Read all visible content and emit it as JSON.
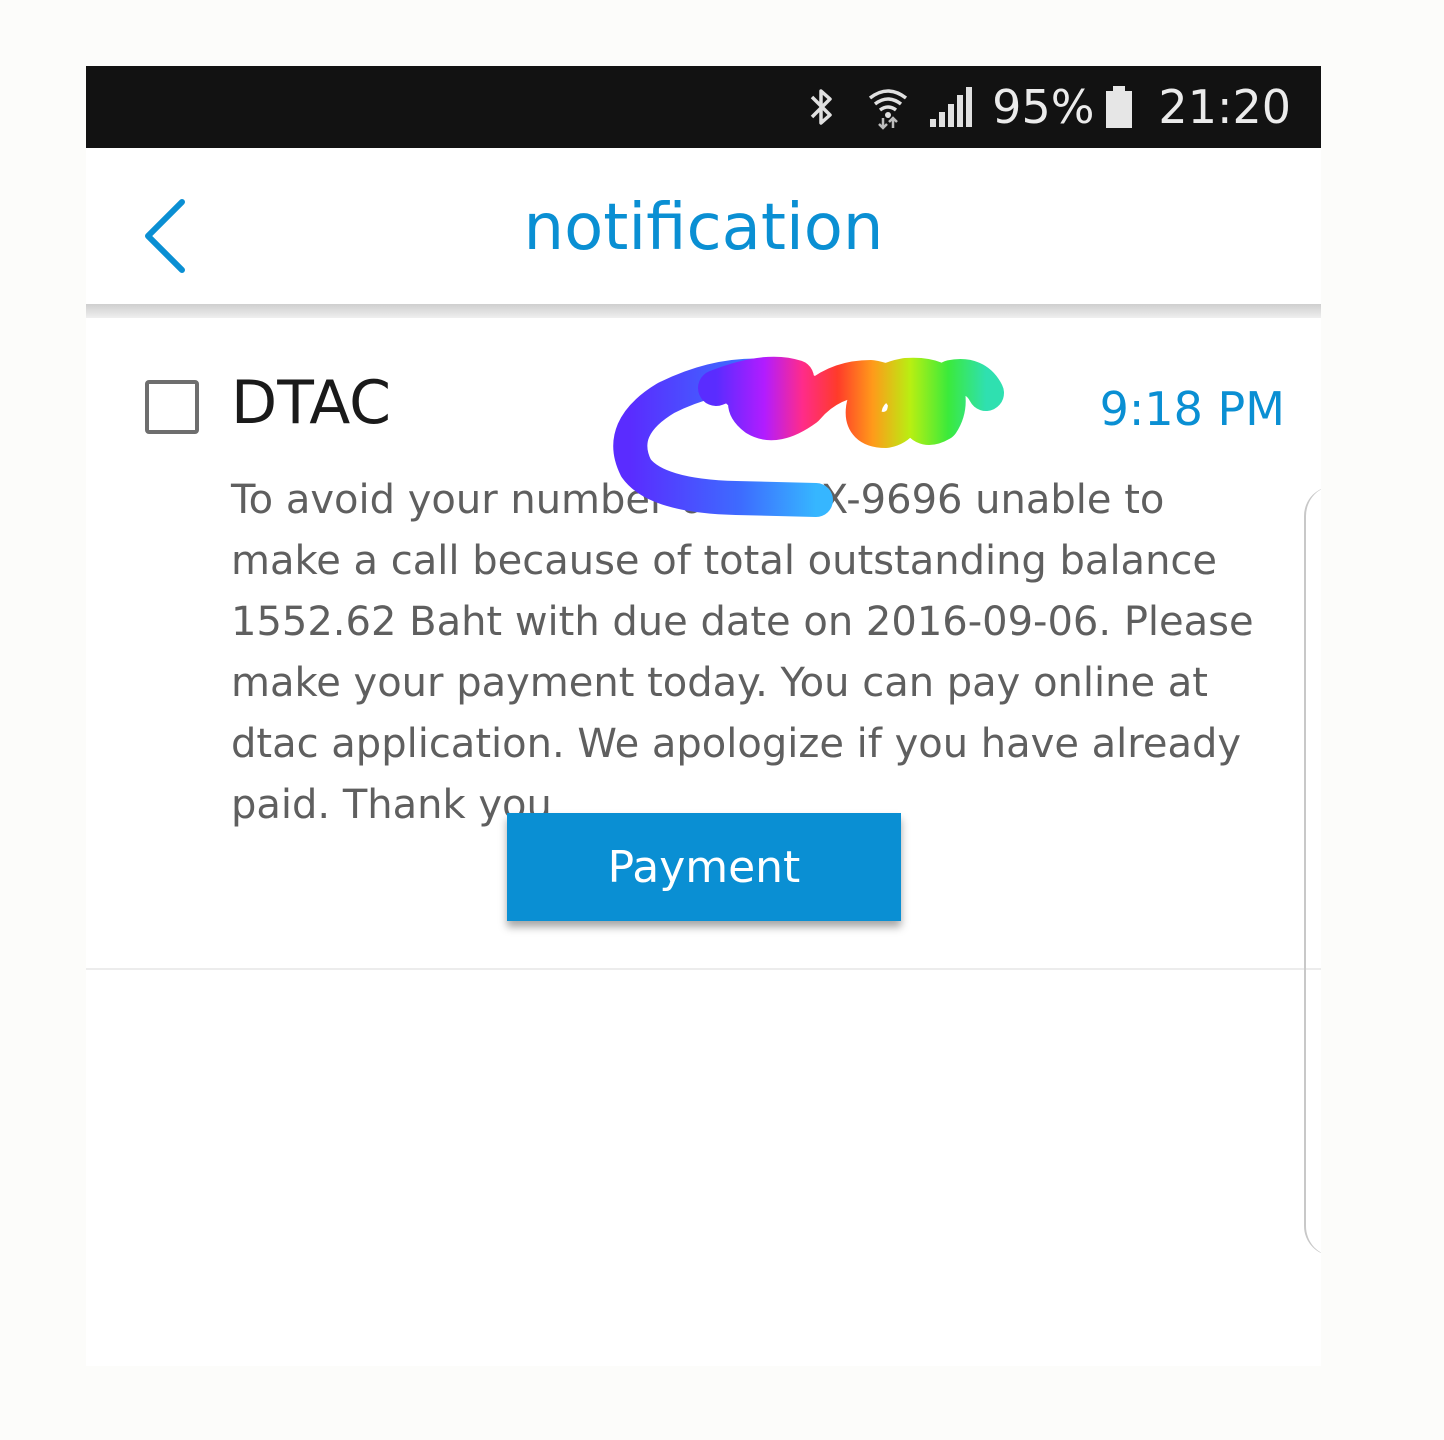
{
  "status_bar": {
    "bluetooth_icon": "bluetooth-icon",
    "wifi_icon": "wifi-icon",
    "signal_icon": "signal-icon",
    "battery_text": "95%",
    "battery_icon": "battery-icon",
    "clock": "21:20"
  },
  "header": {
    "back_icon": "chevron-left-icon",
    "title": "notification"
  },
  "notification": {
    "checked": false,
    "sender": "DTAC",
    "time": "9:18 PM",
    "message": "To avoid your number 0000-XX-9696  unable to make a call because of total outstanding balance 1552.62 Baht with due date on 2016-09-06. Please make your payment today. You can pay online at dtac application. We apologize if you have already paid. Thank you",
    "button_label": "Payment"
  },
  "colors": {
    "accent": "#0a8fd3",
    "status_bar_bg": "#121212",
    "message_text": "#5f5f5f"
  }
}
